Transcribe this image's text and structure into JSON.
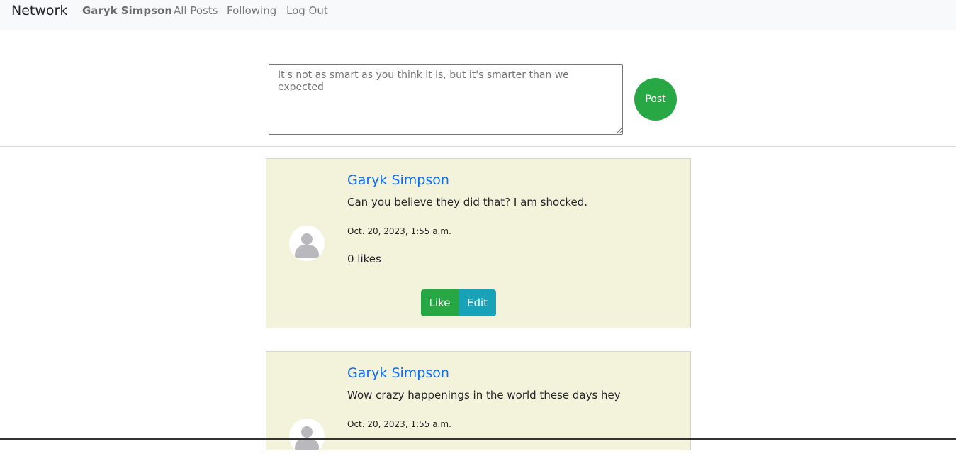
{
  "nav": {
    "brand": "Network",
    "user": "Garyk Simpson",
    "all_posts": "All Posts",
    "following": "Following",
    "logout": "Log Out"
  },
  "composer": {
    "placeholder": "It's not as smart as you think it is, but it's smarter than we expected",
    "value": "",
    "post_label": "Post"
  },
  "posts": [
    {
      "author": "Garyk Simpson",
      "content": "Can you believe they did that? I am shocked.",
      "timestamp": "Oct. 20, 2023, 1:55 a.m.",
      "likes": "0 likes",
      "like_label": "Like",
      "edit_label": "Edit"
    },
    {
      "author": "Garyk Simpson",
      "content": "Wow crazy happenings in the world these days hey",
      "timestamp": "Oct. 20, 2023, 1:55 a.m."
    }
  ],
  "colors": {
    "navbar_bg": "#f8f9fa",
    "post_button": "#28a745",
    "like_button": "#28a745",
    "edit_button": "#17a2b8",
    "card_bg": "#f3f3dc",
    "author_link": "#0d6efd"
  }
}
